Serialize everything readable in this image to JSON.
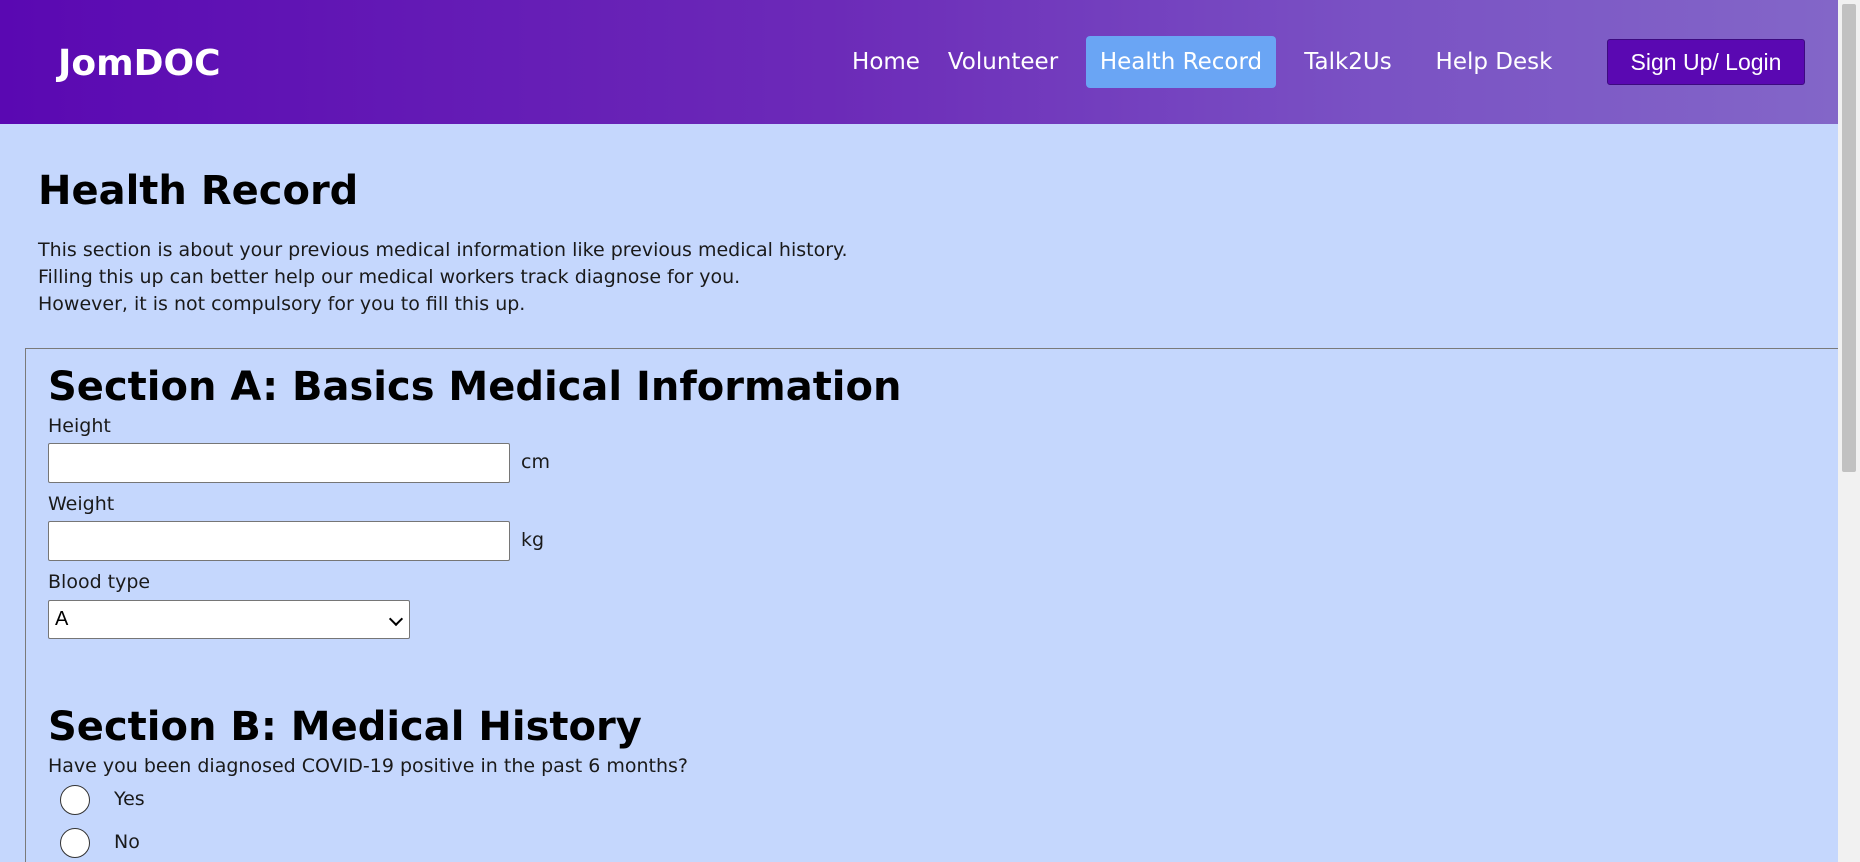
{
  "header": {
    "brand": "JomDOC",
    "nav": [
      {
        "label": "Home",
        "active": false
      },
      {
        "label": "Volunteer",
        "active": false
      },
      {
        "label": "Health Record",
        "active": true
      },
      {
        "label": "Talk2Us",
        "active": false
      },
      {
        "label": "Help Desk",
        "active": false
      }
    ],
    "signup_label": "Sign Up/ Login"
  },
  "page": {
    "title": "Health Record",
    "intro": [
      "This section is about your previous medical information like previous medical history.",
      "Filling this up can better help our medical workers track diagnose for you.",
      "However, it is not compulsory for you to fill this up."
    ]
  },
  "section_a": {
    "heading": "Section A: Basics Medical Information",
    "height": {
      "label": "Height",
      "value": "",
      "unit": "cm"
    },
    "weight": {
      "label": "Weight",
      "value": "",
      "unit": "kg"
    },
    "blood_type": {
      "label": "Blood type",
      "selected": "A"
    }
  },
  "section_b": {
    "heading": "Section B: Medical History",
    "question": "Have you been diagnosed COVID-19 positive in the past 6 months?",
    "options": [
      {
        "label": "Yes",
        "checked": false
      },
      {
        "label": "No",
        "checked": false
      }
    ]
  },
  "colors": {
    "page_background": "#c5d7fd",
    "header_gradient_start": "#5a08b2",
    "header_gradient_end": "#8366c8",
    "active_nav": "#6aa5f4",
    "signup_button": "#5a08b2"
  }
}
